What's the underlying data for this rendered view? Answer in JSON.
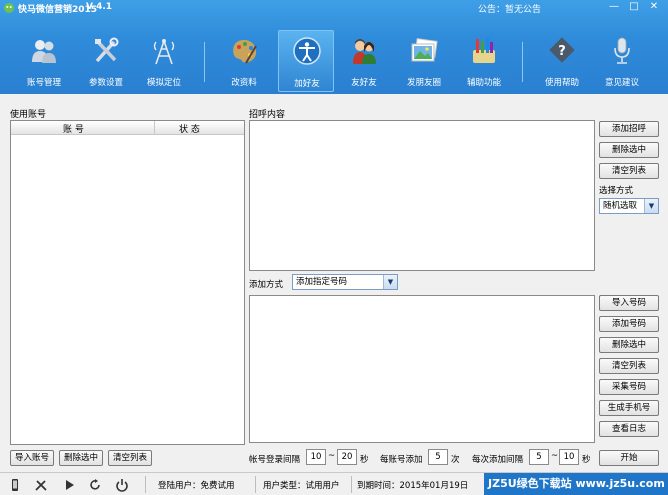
{
  "window": {
    "title": "快马微信营销2015",
    "version": "V 4.1",
    "notice": "公告：暂无公告",
    "controls": {
      "minimize": "—",
      "maximize": "□",
      "close": "✕"
    }
  },
  "toolbar": [
    {
      "label": "账号管理",
      "icon": "users-icon"
    },
    {
      "label": "参数设置",
      "icon": "tools-icon"
    },
    {
      "label": "模拟定位",
      "icon": "tower-icon"
    },
    {
      "label": "改资料",
      "icon": "palette-icon"
    },
    {
      "label": "加好友",
      "icon": "accessibility-icon",
      "active": true
    },
    {
      "label": "友好友",
      "icon": "people-icon"
    },
    {
      "label": "发朋友圈",
      "icon": "photos-icon"
    },
    {
      "label": "辅助功能",
      "icon": "utensils-icon"
    },
    {
      "label": "使用帮助",
      "icon": "help-icon"
    },
    {
      "label": "意见建议",
      "icon": "microphone-icon"
    }
  ],
  "accounts": {
    "caption": "使用账号",
    "col_account": "账  号",
    "col_status": "状  态",
    "import_btn": "导入账号",
    "delete_btn": "删除选中",
    "clear_btn": "清空列表"
  },
  "greeting": {
    "caption": "招呼内容",
    "add_btn": "添加招呼",
    "delete_btn": "删除选中",
    "clear_btn": "清空列表",
    "select_label": "选择方式",
    "select_value": "随机选取"
  },
  "numbers": {
    "method_label": "添加方式",
    "method_value": "添加指定号码",
    "import_btn": "导入号码",
    "add_btn": "添加号码",
    "delete_btn": "删除选中",
    "clear_btn": "清空列表",
    "collect_btn": "采集号码",
    "generate_btn": "生成手机号",
    "log_btn": "查看日志"
  },
  "params": {
    "login_interval_label": "帐号登录间隔",
    "login_min": "10",
    "tilde1": "~",
    "login_max": "20",
    "sec1": "秒",
    "per_account_label": "每账号添加",
    "per_account_value": "5",
    "times_unit": "次",
    "add_interval_label": "每次添加间隔",
    "add_min": "5",
    "tilde2": "~",
    "add_max": "10",
    "sec2": "秒",
    "start_btn": "开始"
  },
  "status": {
    "login_user": "登陆用户：免费试用",
    "user_type": "用户类型：试用用户",
    "expire": "到期时间：2015年01月19日"
  },
  "watermark": "JZ5U绿色下载站 www.jz5u.com"
}
